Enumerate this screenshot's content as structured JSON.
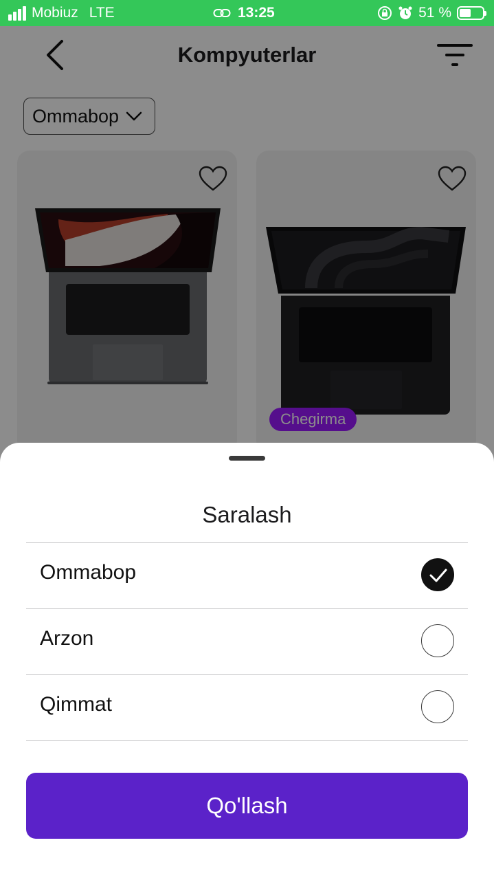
{
  "status_bar": {
    "carrier": "Mobiuz",
    "network": "LTE",
    "time": "13:25",
    "battery": "51 %",
    "battery_level": 0.51
  },
  "header": {
    "title": "Kompyuterlar",
    "back_icon": "chevron-left-icon",
    "filter_icon": "filter-icon"
  },
  "sort": {
    "current": "Ommabop"
  },
  "products": [
    {
      "favorite": false
    },
    {
      "favorite": false,
      "badge": "Chegirma"
    }
  ],
  "sheet": {
    "title": "Saralash",
    "options": [
      {
        "label": "Ommabop",
        "selected": true
      },
      {
        "label": "Arzon",
        "selected": false
      },
      {
        "label": "Qimmat",
        "selected": false
      }
    ],
    "apply_label": "Qo'llash"
  },
  "colors": {
    "status_bar": "#34c759",
    "accent": "#5b22c9",
    "badge": "#9b1aff"
  }
}
